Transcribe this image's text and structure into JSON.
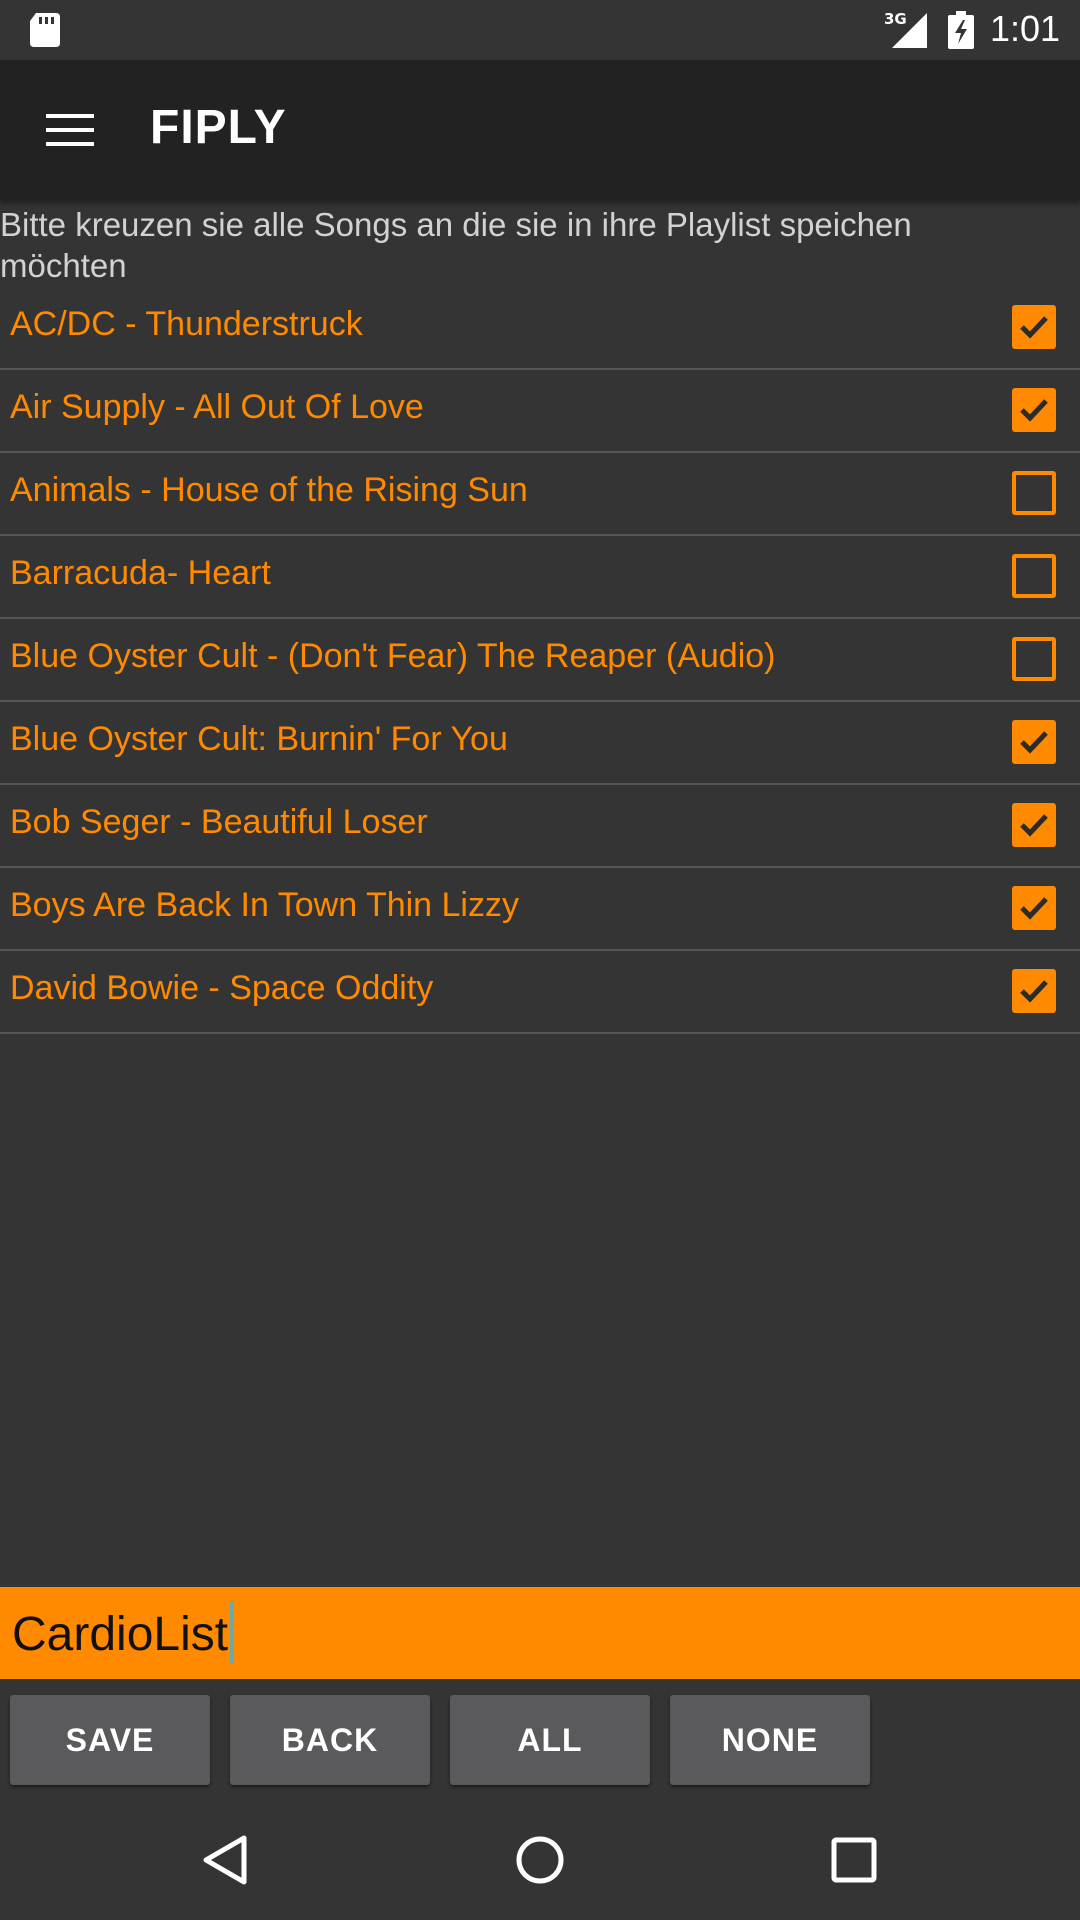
{
  "status_bar": {
    "network": "3G",
    "time": "1:01",
    "icons": [
      "sd-card-icon",
      "signal-icon",
      "battery-icon"
    ]
  },
  "app_bar": {
    "title": "FIPLY",
    "menu_icon": "hamburger-menu-icon"
  },
  "instruction": "Bitte kreuzen sie alle Songs an die sie in ihre Playlist speichen möchten",
  "songs": [
    {
      "title": "AC/DC - Thunderstruck",
      "checked": true
    },
    {
      "title": "Air Supply - All Out Of Love",
      "checked": true
    },
    {
      "title": "Animals - House of the Rising Sun",
      "checked": false
    },
    {
      "title": "Barracuda- Heart",
      "checked": false
    },
    {
      "title": "Blue Oyster Cult - (Don't Fear) The Reaper (Audio)",
      "checked": false
    },
    {
      "title": "Blue Oyster Cult: Burnin' For You",
      "checked": true
    },
    {
      "title": "Bob Seger - Beautiful Loser",
      "checked": true
    },
    {
      "title": "Boys Are Back In Town Thin Lizzy",
      "checked": true
    },
    {
      "title": "David Bowie - Space Oddity",
      "checked": true
    }
  ],
  "playlist_input": {
    "value": "CardioList"
  },
  "buttons": {
    "save": "SAVE",
    "back": "BACK",
    "all": "ALL",
    "none": "NONE"
  },
  "nav_bar": {
    "icons": [
      "back-icon",
      "home-icon",
      "recents-icon"
    ]
  },
  "colors": {
    "accent": "#ff8a00",
    "background": "#353434",
    "app_bar": "#222222",
    "button": "#5a5a5c"
  }
}
